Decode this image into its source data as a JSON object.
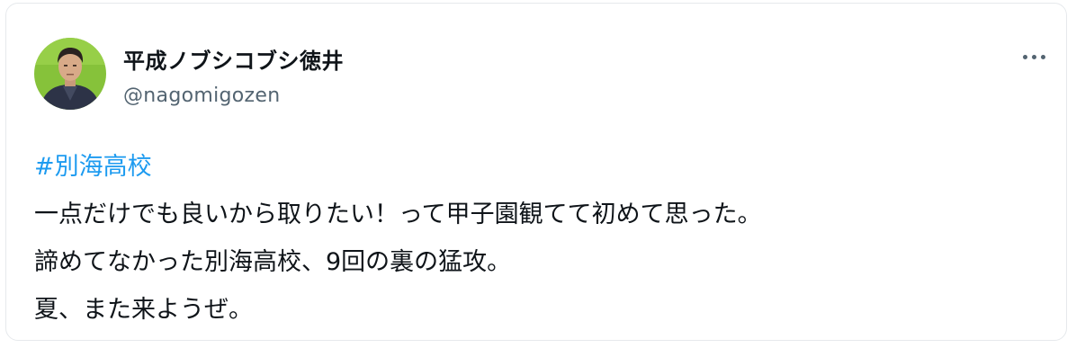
{
  "author": {
    "display_name": "平成ノブシコブシ徳井",
    "handle": "@nagomigozen",
    "avatar_icon": "user-avatar-photo"
  },
  "menu": {
    "icon": "more-dots-icon"
  },
  "tweet": {
    "hashtag": "#別海高校",
    "lines": [
      "一点だけでも良いから取りたい！って甲子園観てて初めて思った。",
      "諦めてなかった別海高校、9回の裏の猛攻。",
      "夏、また来ようぜ。"
    ]
  },
  "colors": {
    "text": "#0f1419",
    "secondary": "#536471",
    "link": "#1d9bf0",
    "avatar_bg": "#86c23a"
  }
}
